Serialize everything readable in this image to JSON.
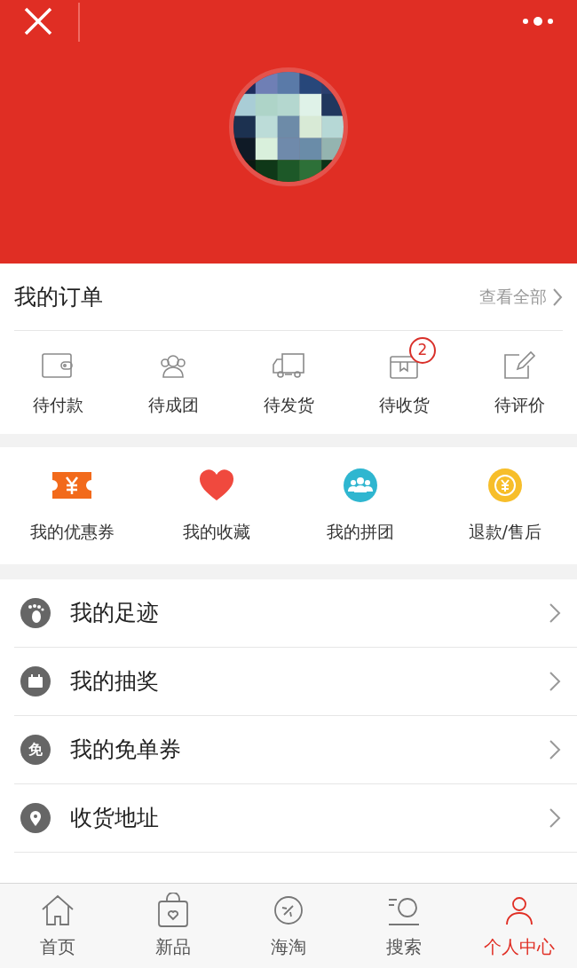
{
  "orders": {
    "title": "我的订单",
    "view_all": "查看全部",
    "items": [
      {
        "kind": "wallet",
        "label": "待付款"
      },
      {
        "kind": "group",
        "label": "待成团"
      },
      {
        "kind": "truck",
        "label": "待发货"
      },
      {
        "kind": "box",
        "label": "待收货",
        "badge": "2"
      },
      {
        "kind": "edit",
        "label": "待评价"
      }
    ]
  },
  "services": [
    {
      "kind": "coupon",
      "label": "我的优惠券",
      "color": "#f26a1b"
    },
    {
      "kind": "heart",
      "label": "我的收藏",
      "color": "#f0493e"
    },
    {
      "kind": "team",
      "label": "我的拼团",
      "color": "#2fb6d0"
    },
    {
      "kind": "refund",
      "label": "退款/售后",
      "color": "#f7be2a"
    }
  ],
  "menu": [
    {
      "kind": "footprint",
      "label": "我的足迹"
    },
    {
      "kind": "lottery",
      "label": "我的抽奖"
    },
    {
      "kind": "free",
      "label": "我的免单券",
      "icon_text": "免"
    },
    {
      "kind": "location",
      "label": "收货地址"
    }
  ],
  "tabbar": [
    {
      "kind": "home",
      "label": "首页",
      "selected": false
    },
    {
      "kind": "bag",
      "label": "新品",
      "selected": false
    },
    {
      "kind": "globe",
      "label": "海淘",
      "selected": false
    },
    {
      "kind": "search",
      "label": "搜索",
      "selected": false
    },
    {
      "kind": "person",
      "label": "个人中心",
      "selected": true
    }
  ]
}
